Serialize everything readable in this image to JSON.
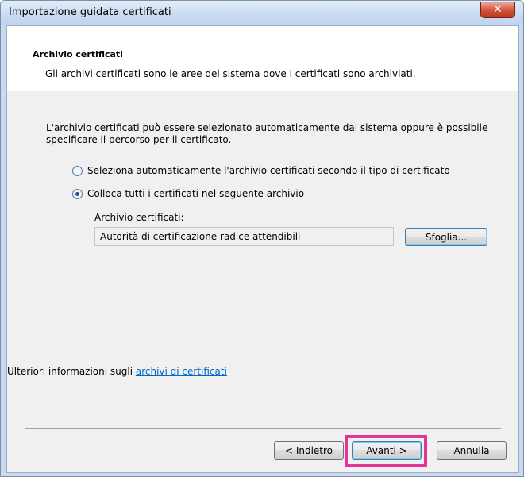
{
  "window": {
    "title": "Importazione guidata certificati",
    "close_glyph": "✕"
  },
  "header": {
    "title": "Archivio certificati",
    "subtitle": "Gli archivi certificati sono le aree del sistema dove i certificati sono archiviati."
  },
  "body": {
    "intro": "L'archivio certificati può essere selezionato automaticamente dal sistema oppure è possibile specificare il percorso per il certificato.",
    "radio_auto_label": "Seleziona automaticamente l'archivio certificati secondo il tipo di certificato",
    "radio_auto_checked": false,
    "radio_manual_label": "Colloca tutti i certificati nel seguente archivio",
    "radio_manual_checked": true,
    "store_label": "Archivio certificati:",
    "store_value": "Autorità di certificazione radice attendibili",
    "browse_label": "Sfoglia...",
    "more_info_text": "Ulteriori informazioni sugli ",
    "more_info_link": "archivi di certificati"
  },
  "footer": {
    "back_label": "< Indietro",
    "next_label": "Avanti >",
    "cancel_label": "Annulla"
  },
  "colors": {
    "highlight": "#e33596",
    "link": "#0066cc",
    "close_button": "#c0361e"
  }
}
